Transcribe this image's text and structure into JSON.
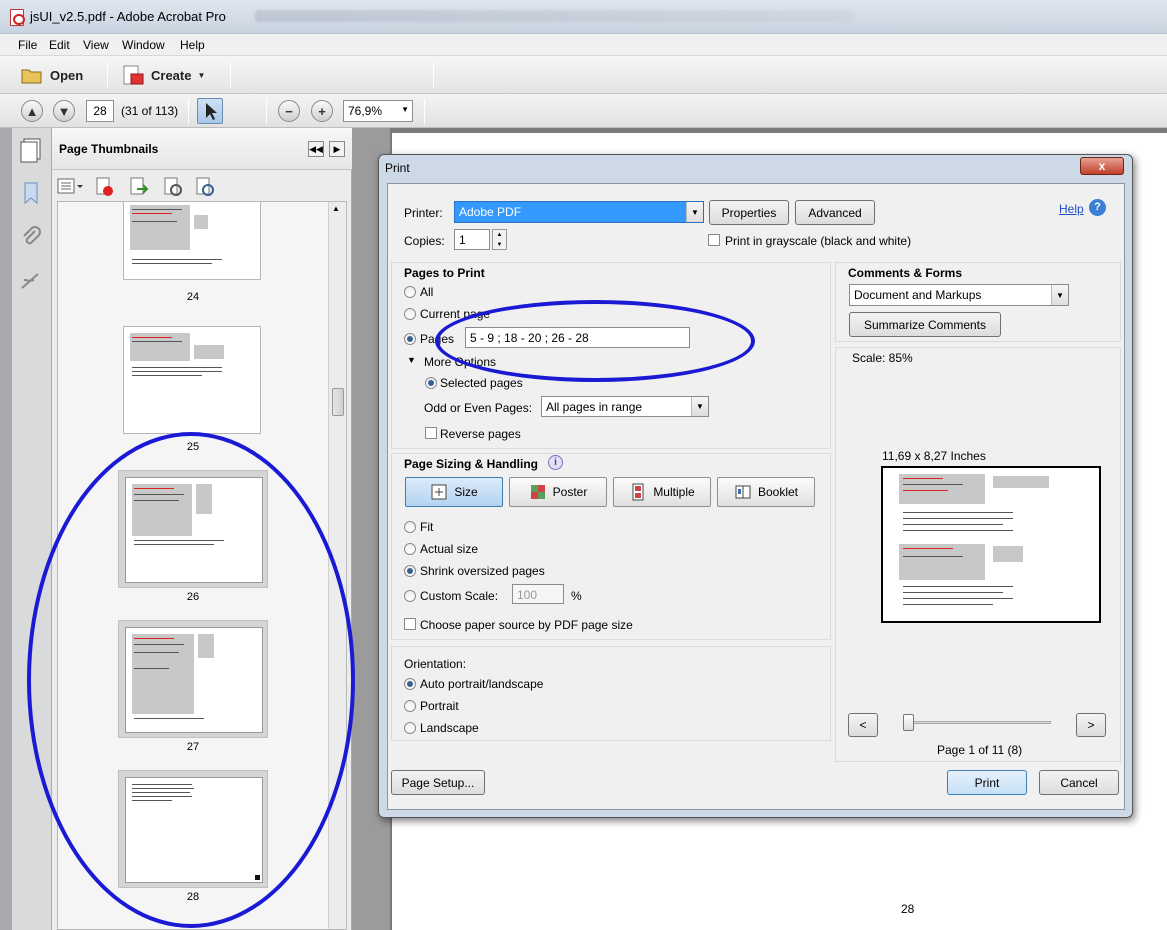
{
  "window": {
    "title": "jsUI_v2.5.pdf - Adobe Acrobat Pro"
  },
  "menu": [
    "File",
    "Edit",
    "View",
    "Window",
    "Help"
  ],
  "toolbar": {
    "open_label": "Open",
    "create_label": "Create"
  },
  "nav": {
    "page_number": "28",
    "page_count": "(31 of 113)",
    "zoom": "76,9%"
  },
  "panel": {
    "title": "Page Thumbnails",
    "thumbnails": [
      "24",
      "25",
      "26",
      "27",
      "28"
    ]
  },
  "document": {
    "page_footer": "28"
  },
  "dialog": {
    "title": "Print",
    "close_label": "x",
    "printer_label": "Printer:",
    "printer_value": "Adobe PDF",
    "properties_label": "Properties",
    "advanced_label": "Advanced",
    "help_label": "Help",
    "copies_label": "Copies:",
    "copies_value": "1",
    "grayscale_label": "Print in grayscale (black and white)",
    "pages_to_print": {
      "title": "Pages to Print",
      "all": "All",
      "current": "Current page",
      "pages": "Pages",
      "pages_value": "5 - 9 ; 18 - 20 ; 26 - 28",
      "more_options": "More Options",
      "selected_pages": "Selected pages",
      "odd_even_label": "Odd or Even Pages:",
      "odd_even_value": "All pages in range",
      "reverse": "Reverse pages"
    },
    "sizing": {
      "title": "Page Sizing & Handling",
      "tabs": [
        "Size",
        "Poster",
        "Multiple",
        "Booklet"
      ],
      "fit": "Fit",
      "actual": "Actual size",
      "shrink": "Shrink oversized pages",
      "custom": "Custom Scale:",
      "custom_value": "100",
      "percent": "%",
      "paper_source": "Choose paper source by PDF page size"
    },
    "orientation": {
      "title": "Orientation:",
      "auto": "Auto portrait/landscape",
      "portrait": "Portrait",
      "landscape": "Landscape"
    },
    "comments": {
      "title": "Comments & Forms",
      "value": "Document and Markups",
      "summarize": "Summarize Comments"
    },
    "preview": {
      "scale": "Scale:  85%",
      "paper_size": "11,69 x 8,27 Inches",
      "page_info": "Page 1 of 11 (8)",
      "prev": "<",
      "next": ">"
    },
    "page_setup_label": "Page Setup...",
    "print_label": "Print",
    "cancel_label": "Cancel"
  },
  "colors": {
    "annotation_ring": "#1a1ad4",
    "selected_field": "#3399ff"
  }
}
